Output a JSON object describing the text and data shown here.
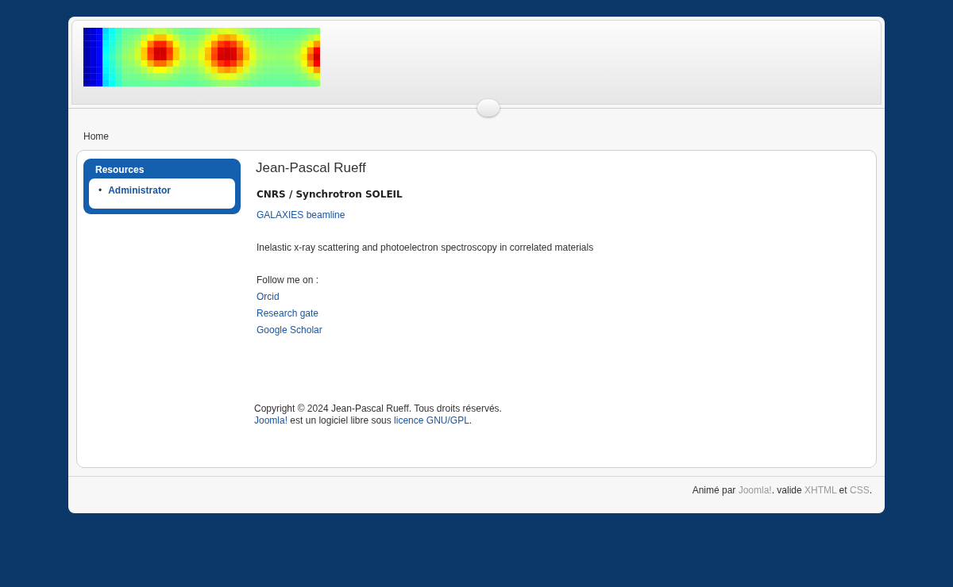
{
  "breadcrumb": "Home",
  "sidebar": {
    "title": "Resources",
    "items": [
      {
        "marker": "•",
        "label": "Administrator"
      }
    ]
  },
  "article": {
    "title": "Jean-Pascal Rueff",
    "affiliation": "CNRS / Synchrotron SOLEIL",
    "beamline_link": "GALAXIES beamline",
    "description": "Inelastic x-ray scattering and photoelectron spectroscopy in correlated materials",
    "follow_label": "Follow me on :",
    "links": [
      "Orcid",
      "Research gate",
      "Google Scholar"
    ]
  },
  "copyright": "Copyright © 2024 Jean-Pascal Rueff. Tous droits réservés.",
  "license_line": [
    {
      "text": "Joomla!",
      "link": true
    },
    {
      "text": " est un logiciel libre sous ",
      "link": false
    },
    {
      "text": "licence GNU/GPL",
      "link": true
    },
    {
      "text": ".",
      "link": false
    }
  ],
  "footer_line": [
    {
      "text": "Animé par ",
      "link": false
    },
    {
      "text": "Joomla!",
      "link": true
    },
    {
      "text": ". valide ",
      "link": false
    },
    {
      "text": "XHTML",
      "link": true
    },
    {
      "text": " et ",
      "link": false
    },
    {
      "text": "CSS",
      "link": true
    },
    {
      "text": ".",
      "link": false
    }
  ]
}
